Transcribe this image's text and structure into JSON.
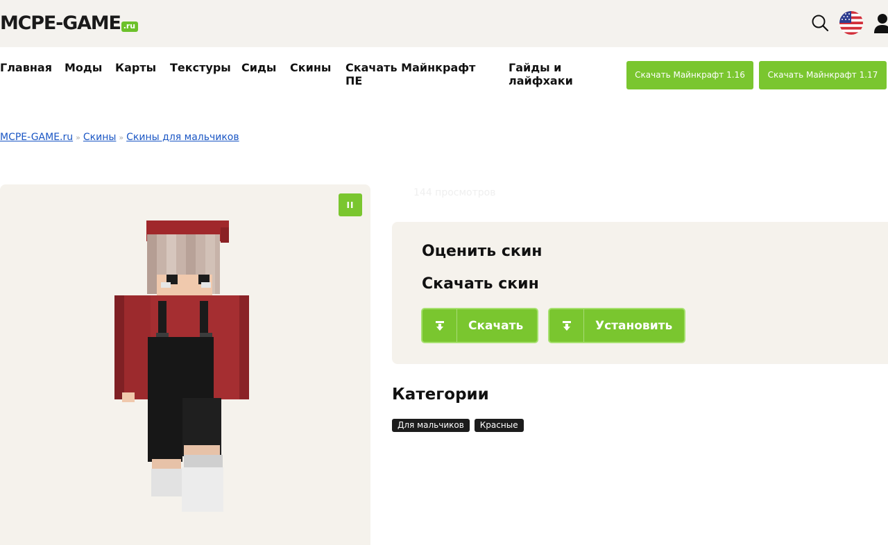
{
  "header": {
    "logo_main": "MCPE-GAME",
    "logo_suffix": ".ru"
  },
  "nav": {
    "items": [
      {
        "label": "Главная"
      },
      {
        "label": "Моды"
      },
      {
        "label": "Карты"
      },
      {
        "label": "Текстуры"
      },
      {
        "label": "Сиды"
      },
      {
        "label": "Скины"
      },
      {
        "label": "Скачать Майнкрафт ПЕ"
      },
      {
        "label": "Гайды и лайфхаки"
      }
    ],
    "buttons": [
      {
        "label": "Скачать Майнкрафт 1.16"
      },
      {
        "label": "Скачать Майнкрафт 1.17"
      }
    ]
  },
  "breadcrumb": {
    "items": [
      "MCPE-GAME.ru",
      "Скины",
      "Скины для мальчиков"
    ],
    "separator": "»"
  },
  "preview": {
    "pause_label": "II"
  },
  "views": "144 просмотров",
  "panel": {
    "rate_title": "Оценить скин",
    "download_title": "Скачать скин",
    "download_button": "Скачать",
    "install_button": "Установить"
  },
  "categories": {
    "title": "Категории",
    "tags": [
      "Для мальчиков",
      "Красные"
    ]
  },
  "colors": {
    "accent": "#7ac62f",
    "link": "#1a56c4",
    "panel_bg": "#f5f2ec",
    "tag_bg": "#1c1c1c"
  }
}
